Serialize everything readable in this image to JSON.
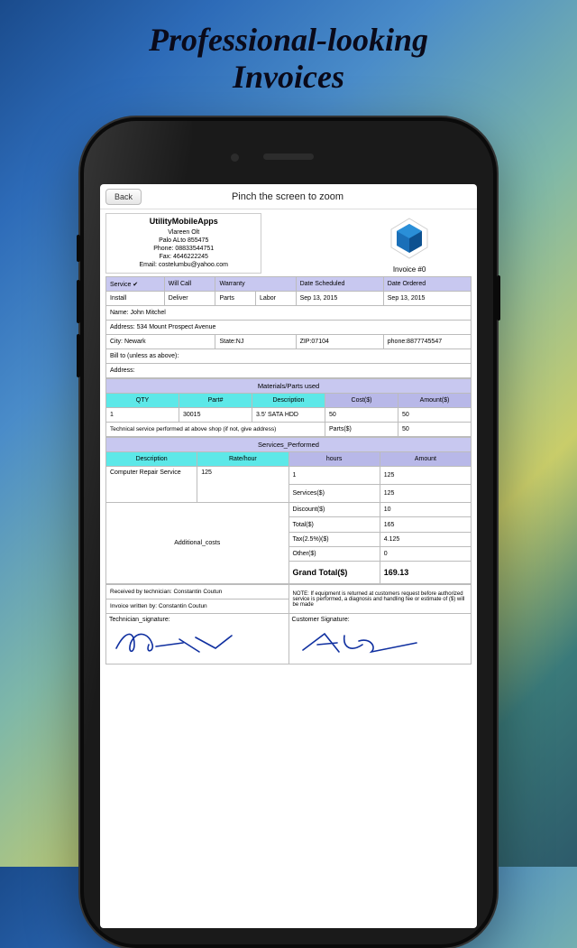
{
  "headline_l1": "Professional-looking",
  "headline_l2": "Invoices",
  "back": "Back",
  "title": "Pinch the screen to zoom",
  "company": {
    "name": "UtilityMobileApps",
    "addr1": "Vlareen Olt",
    "addr2": "Palo ALto 855475",
    "phone": "Phone: 08833544751",
    "fax": "Fax: 4646222245",
    "email": "Email: costelumbu@yahoo.com"
  },
  "invoice_label": "Invoice #0",
  "row1": {
    "service": "Service ✔",
    "willcall": "Will Call",
    "warranty": "Warranty",
    "datesched": "Date Scheduled",
    "dateord": "Date Ordered"
  },
  "row2": {
    "install": "Install",
    "deliver": "Deliver",
    "parts": "Parts",
    "labor": "Labor",
    "d1": "Sep 13, 2015",
    "d2": "Sep 13, 2015"
  },
  "cust": {
    "name": "Name: John Mitchel",
    "addr": "Address: 534 Mount Prospect Avenue",
    "city": "City: Newark",
    "state": "State:NJ",
    "zip": "ZIP:07104",
    "phone": "phone:8877745547",
    "billto": "Bill to (unless as above):",
    "address2": "Address:"
  },
  "materials": {
    "title": "Materials/Parts used",
    "h": {
      "qty": "QTY",
      "part": "Part#",
      "desc": "Description",
      "cost": "Cost($)",
      "amount": "Amount($)"
    },
    "r1": {
      "qty": "1",
      "part": "30015",
      "desc": "3.5' SATA HDD",
      "cost": "50",
      "amount": "50"
    },
    "note": "Technical service performed at above shop (if not, give address)",
    "parts_label": "Parts($)",
    "parts_val": "50"
  },
  "services": {
    "title": "Services_Performed",
    "h": {
      "desc": "Description",
      "rate": "Rate/hour",
      "hours": "hours",
      "amount": "Amount"
    },
    "r1": {
      "desc": "Computer Repair Service",
      "rate": "125",
      "hours": "1",
      "amount": "125"
    },
    "additional": "Additional_costs"
  },
  "totals": {
    "services": {
      "l": "Services($)",
      "v": "125"
    },
    "discount": {
      "l": "Discount($)",
      "v": "10"
    },
    "total": {
      "l": "Total($)",
      "v": "165"
    },
    "tax": {
      "l": "Tax(2.5%)($)",
      "v": "4.125"
    },
    "other": {
      "l": "Other($)",
      "v": "0"
    },
    "grand": {
      "l": "Grand Total($)",
      "v": "169.13"
    }
  },
  "footer": {
    "received": "Received by technician: Constantin Coutun",
    "written": "Invoice written by: Constantin Coutun",
    "note": "NOTE: If equipment is returned at customers request before authorized service is performed, a diagnosis and handling fee or estimate of ($) will be made"
  },
  "sig": {
    "tech": "Technician_signature:",
    "cust": "Customer Signature:"
  }
}
